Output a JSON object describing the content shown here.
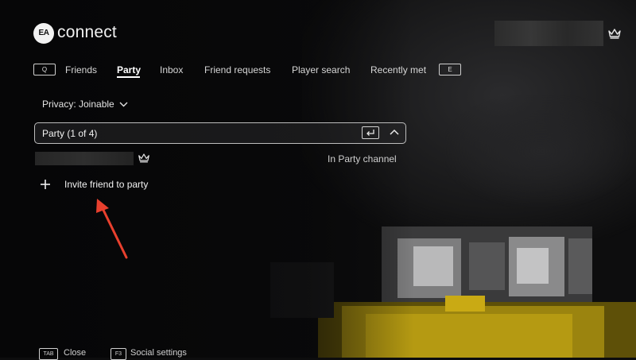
{
  "app": {
    "logo_mark": "EA",
    "title": "connect"
  },
  "tabs": {
    "left_key": "Q",
    "right_key": "E",
    "items": [
      {
        "label": "Friends"
      },
      {
        "label": "Party",
        "active": true
      },
      {
        "label": "Inbox"
      },
      {
        "label": "Friend requests"
      },
      {
        "label": "Player search"
      },
      {
        "label": "Recently met"
      }
    ]
  },
  "privacy": {
    "label": "Privacy: Joinable"
  },
  "party": {
    "title": "Party (1 of 4)",
    "member_status": "In Party channel",
    "invite_label": "Invite friend to party"
  },
  "footer": {
    "close_key": "TAB",
    "close_label": "Close",
    "settings_key": "F3",
    "settings_label": "Social settings"
  },
  "icons": {
    "header_crown": "crown-icon",
    "member_crown": "crown-icon",
    "enter": "enter-key-icon",
    "collapse": "chevron-up-icon",
    "privacy_dropdown": "chevron-down-icon",
    "invite": "plus-icon",
    "annotation": "red-arrow-icon"
  },
  "colors": {
    "background": "#0d0d0e",
    "text": "#e9e9e9",
    "annotation_arrow": "#e8402e",
    "blur_yellow": "#b59a12"
  }
}
